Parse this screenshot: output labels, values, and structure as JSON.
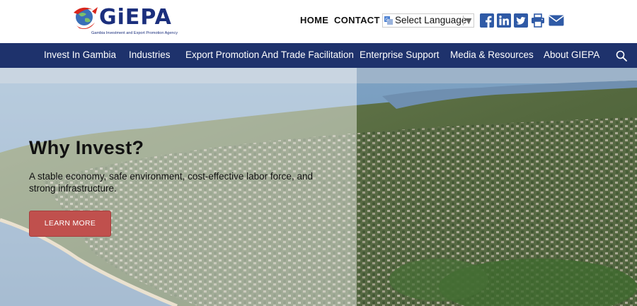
{
  "header": {
    "logo": {
      "name": "GiEPA",
      "tagline": "Gambia Investment and Export Promotion Agency"
    },
    "links": {
      "home": "HOME",
      "contact": "CONTACT"
    },
    "language": {
      "label": "Select Language",
      "icon": "translate-icon",
      "arrow": "▼"
    },
    "social": [
      {
        "name": "facebook-icon"
      },
      {
        "name": "linkedin-icon"
      },
      {
        "name": "twitter-icon"
      },
      {
        "name": "print-icon"
      },
      {
        "name": "email-icon"
      }
    ],
    "colors": {
      "brand_blue": "#1e326c",
      "icon_blue": "#2f5aa6",
      "logo_red": "#d9261c"
    }
  },
  "nav": {
    "items": [
      "Invest In Gambia",
      "Industries",
      "Export Promotion And Trade Facilitation",
      "Enterprise Support",
      "Media & Resources",
      "About GIEPA"
    ],
    "search_icon": "search-icon"
  },
  "hero": {
    "title": "Why Invest?",
    "text": "A stable economy, safe environment, cost-effective labor force, and strong infrastructure.",
    "button": "LEARN MORE",
    "button_color": "#c0504d"
  }
}
